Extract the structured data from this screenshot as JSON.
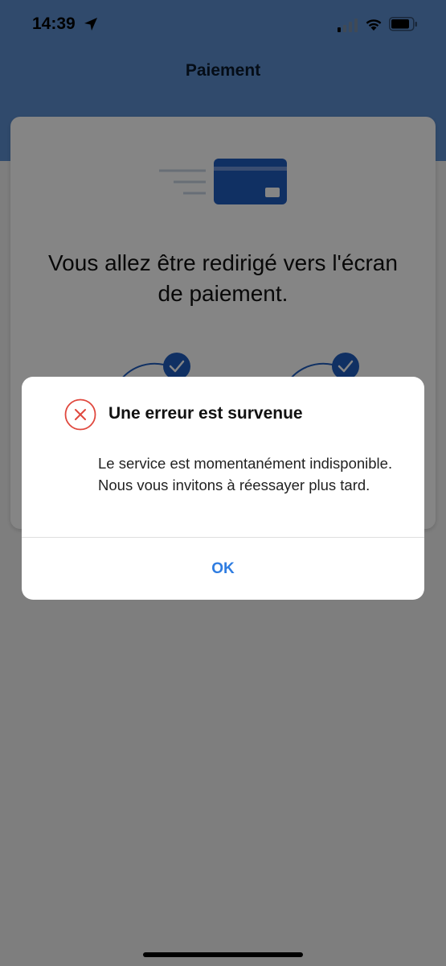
{
  "status_bar": {
    "time": "14:39",
    "icons": [
      "location-arrow-icon",
      "signal-icon",
      "wifi-icon",
      "battery-icon"
    ]
  },
  "header": {
    "title": "Paiement",
    "background_color": "#5d8fd0"
  },
  "card": {
    "illustration_icon": "credit-card-icon",
    "message": "Vous allez être redirigé vers l'écran de paiement.",
    "steps": [
      {
        "icon": "checkmark-icon",
        "status": "done"
      },
      {
        "icon": "checkmark-icon",
        "status": "done"
      }
    ]
  },
  "dialog": {
    "icon": "error-x-icon",
    "title": "Une erreur est survenue",
    "body": "Le service est momentanément indisponible. Nous vous invitons à réessayer plus tard.",
    "ok_label": "OK",
    "error_color": "#e0483e",
    "button_color": "#2f7de1"
  }
}
